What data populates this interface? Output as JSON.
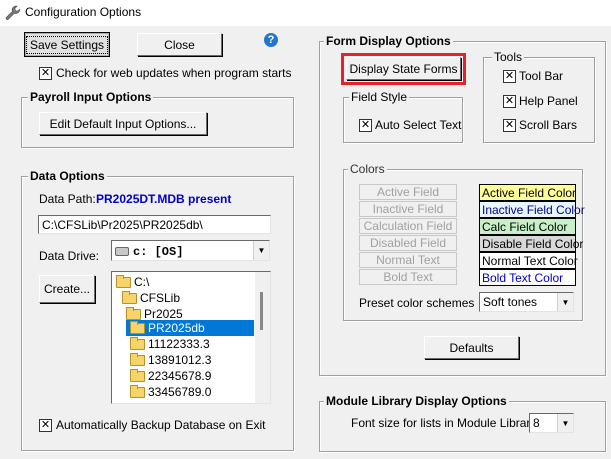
{
  "window": {
    "title": "Configuration Options",
    "icon": "wrench-icon"
  },
  "top": {
    "save_settings": "Save Settings",
    "close": "Close",
    "check_updates": "Check for web updates when program starts",
    "check_updates_checked": "✕"
  },
  "payroll": {
    "title": "Payroll Input Options",
    "edit_default": "Edit Default Input Options..."
  },
  "data_options": {
    "title": "Data Options",
    "data_path_label": "Data Path:",
    "data_path_value": "PR2025DT.MDB present",
    "path_field": "C:\\CFSLib\\Pr2025\\PR2025db\\",
    "data_drive_label": "Data Drive:",
    "data_drive_value": "c: [OS]",
    "create_button": "Create...",
    "folders": [
      {
        "name": "C:\\",
        "level": 0,
        "selected": false
      },
      {
        "name": "CFSLib",
        "level": 1,
        "selected": false
      },
      {
        "name": "Pr2025",
        "level": 2,
        "selected": false
      },
      {
        "name": "PR2025db",
        "level": 3,
        "selected": true
      },
      {
        "name": "11122333.3",
        "level": 4,
        "selected": false
      },
      {
        "name": "13891012.3",
        "level": 4,
        "selected": false
      },
      {
        "name": "22345678.9",
        "level": 4,
        "selected": false
      },
      {
        "name": "33456789.0",
        "level": 4,
        "selected": false
      }
    ],
    "auto_backup": "Automatically Backup Database on Exit",
    "auto_backup_checked": "✕"
  },
  "form_display": {
    "title": "Form Display Options",
    "display_state_forms": "Display State Forms",
    "field_style_title": "Field Style",
    "auto_select_text": "Auto Select Text",
    "auto_select_checked": "✕",
    "tools_title": "Tools",
    "tools": [
      {
        "label": "Tool Bar",
        "mark": "✕"
      },
      {
        "label": "Help Panel",
        "mark": "✕"
      },
      {
        "label": "Scroll Bars",
        "mark": "✕"
      }
    ],
    "colors_title": "Colors",
    "color_buttons": [
      "Active Field",
      "Inactive Field",
      "Calculation Field",
      "Disabled Field",
      "Normal Text",
      "Bold Text"
    ],
    "swatches": [
      {
        "label": "Active Field Color",
        "bg": "#ffff99",
        "fg": "#000000"
      },
      {
        "label": "Inactive Field Color",
        "bg": "#e6f5ff",
        "fg": "#000080"
      },
      {
        "label": "Calc Field Color",
        "bg": "#c8f0c8",
        "fg": "#000000"
      },
      {
        "label": "Disable Field Color",
        "bg": "#d8d8d8",
        "fg": "#000000"
      },
      {
        "label": "Normal Text Color",
        "bg": "#ffffff",
        "fg": "#000000"
      },
      {
        "label": "Bold Text Color",
        "bg": "#ffffff",
        "fg": "#0000c8"
      }
    ],
    "preset_label": "Preset color schemes",
    "preset_value": "Soft tones",
    "defaults_button": "Defaults"
  },
  "module_library": {
    "title": "Module Library Display Options",
    "font_size_label": "Font size for lists in Module Library",
    "font_size_value": "8"
  },
  "colors": {
    "accent": "#0078d7",
    "highlight": "#e8202a",
    "path_blue": "#0000c8"
  }
}
